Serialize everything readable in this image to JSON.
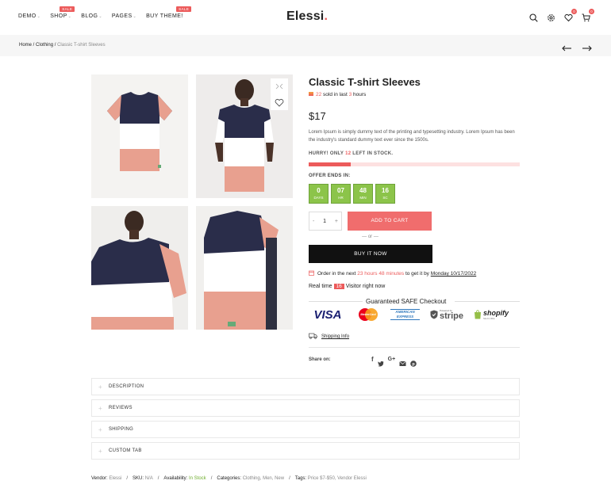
{
  "header": {
    "nav": [
      {
        "label": "DEMO",
        "chevron": true,
        "badge": ""
      },
      {
        "label": "SHOP",
        "chevron": true,
        "badge": "SALE"
      },
      {
        "label": "BLOG",
        "chevron": true,
        "badge": ""
      },
      {
        "label": "PAGES",
        "chevron": true,
        "badge": ""
      },
      {
        "label": "BUY THEME!",
        "chevron": false,
        "badge": "SALE"
      }
    ],
    "logo_text": "Elessi",
    "logo_dot": ".",
    "wishlist_count": "0",
    "cart_count": "0"
  },
  "breadcrumb": {
    "home": "Home",
    "sep1": " / ",
    "category": "Clothing",
    "sep2": " / ",
    "current": "Classic T-shirt Sleeves"
  },
  "product": {
    "title": "Classic T-shirt Sleeves",
    "sold_count": "22",
    "sold_mid": " sold in last ",
    "sold_hours": "3",
    "sold_tail": " hours",
    "price": "$17",
    "description": "Lorem Ipsum is simply dummy text of the printing and typesetting industry. Lorem Ipsum has been the industry's standard dummy text ever since the 1500s.",
    "stock_prefix": "HURRY! ONLY ",
    "stock_count": "12",
    "stock_suffix": " LEFT IN STOCK.",
    "stock_level_fraction": 0.2,
    "offer_label": "OFFER ENDS IN:",
    "countdown": [
      {
        "value": "0",
        "unit": "DAYS"
      },
      {
        "value": "07",
        "unit": "HR"
      },
      {
        "value": "48",
        "unit": "MIN"
      },
      {
        "value": "16",
        "unit": "SC"
      }
    ],
    "quantity": "1",
    "qty_minus": "-",
    "qty_plus": "+",
    "add_to_cart": "ADD TO CART",
    "or_text": "— or —",
    "buy_now": "BUY IT NOW",
    "order_prefix": "Order in the next ",
    "order_time": "23 hours 48 minutes",
    "order_mid": " to get it by ",
    "order_date": "Monday 10/17/2022",
    "visitor_prefix": "Real time ",
    "visitor_count": "16",
    "visitor_suffix": " Visitor right now",
    "safe_checkout": "Guaranteed SAFE Checkout",
    "payments": [
      "VISA",
      "MasterCard",
      "AMERICAN EXPRESS",
      "stripe",
      "shopify"
    ],
    "powered_by": "Powered by",
    "shopify_sub": "SECURE",
    "shipping_info": "Shipping Info",
    "share_label": "Share on:",
    "socials": [
      "facebook-icon",
      "twitter-icon",
      "google-plus-icon",
      "email-icon",
      "pinterest-icon"
    ]
  },
  "tabs": [
    "DESCRIPTION",
    "REVIEWS",
    "SHIPPING",
    "CUSTOM TAB"
  ],
  "meta": {
    "vendor_label": "Vendor:",
    "vendor": "Elessi",
    "sku_label": "SKU:",
    "sku": "N/A",
    "availability_label": "Availability:",
    "availability": "In Stock",
    "categories_label": "Categories:",
    "categories": "Clothing, Men, New",
    "tags_label": "Tags:",
    "tags": "Price $7-$50, Vendor Elessi",
    "sep": "/"
  },
  "colors": {
    "accent": "#ec5b5b",
    "countdown": "#8cc44a",
    "stock_bg": "#fde1e1"
  }
}
